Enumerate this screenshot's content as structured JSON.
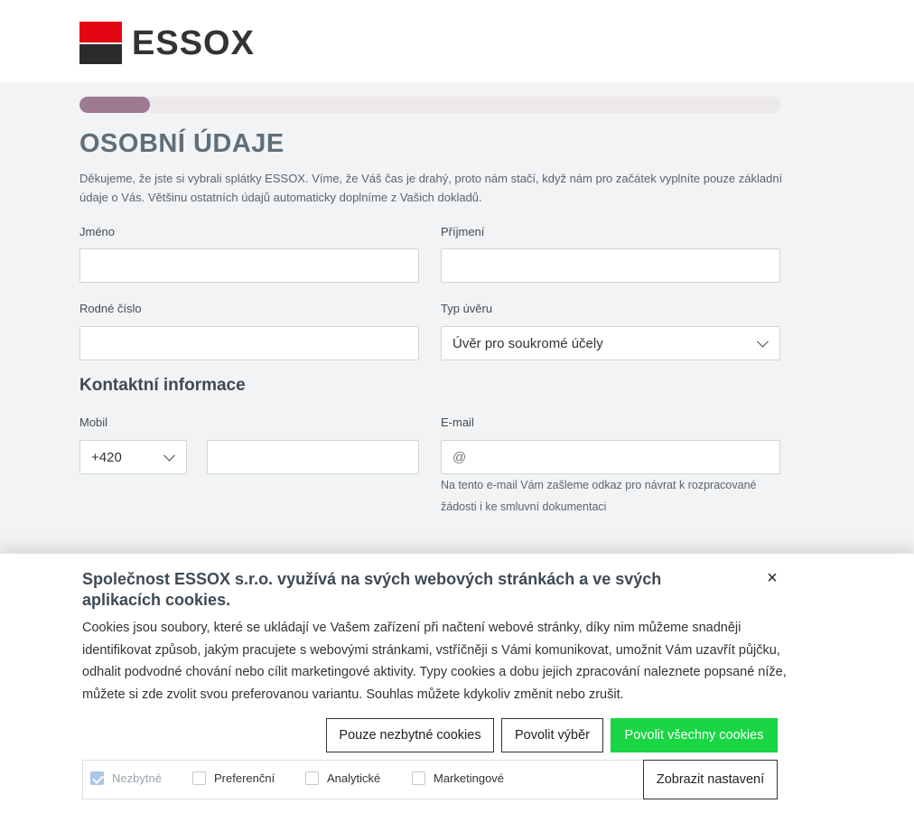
{
  "brand": {
    "name": "ESSOX",
    "red": "#e30613",
    "dark": "#2b2b2b"
  },
  "progress": {
    "fraction": 0.1,
    "fill_color": "#9d7a92"
  },
  "page": {
    "title": "OSOBNÍ ÚDAJE",
    "intro": "Děkujeme, že jste si vybrali splátky ESSOX. Víme, že Váš čas je drahý, proto nám stačí, když nám pro začátek vyplníte pouze základní údaje o Vás. Většinu ostatních údajů automaticky doplníme z Vašich dokladů."
  },
  "form": {
    "first_name": {
      "label": "Jméno",
      "value": ""
    },
    "last_name": {
      "label": "Příjmení",
      "value": ""
    },
    "birth_number": {
      "label": "Rodné číslo",
      "value": ""
    },
    "loan_type": {
      "label": "Typ úvěru",
      "value": "Úvěr pro soukromé účely"
    },
    "contact_section_title": "Kontaktní informace",
    "mobile": {
      "label": "Mobil",
      "prefix": "+420",
      "value": ""
    },
    "email": {
      "label": "E-mail",
      "placeholder": "@",
      "hint": "Na tento e-mail Vám zašleme odkaz pro návrat k rozpracované žádosti i ke smluvní dokumentaci"
    }
  },
  "cookie_banner": {
    "title": "Společnost ESSOX s.r.o. využívá na svých webových stránkách a ve svých aplikacích cookies.",
    "close_label": "×",
    "text": "Cookies jsou soubory, které se ukládají ve Vašem zařízení při načtení webové stránky, díky nim můžeme snadněji identifikovat způsob, jakým pracujete s webovými stránkami, vstříčněji s Vámi komunikovat, umožnit Vám uzavřít půjčku, odhalit podvodné chování nebo cílit marketingové aktivity. Typy cookies a dobu jejich zpracování naleznete popsané níže, můžete si zde zvolit svou preferovanou variantu. Souhlas můžete kdykoliv změnit nebo zrušit.",
    "buttons": {
      "necessary_only": "Pouze nezbytné cookies",
      "allow_selection": "Povolit výběr",
      "allow_all": "Povolit všechny cookies",
      "show_settings": "Zobrazit nastavení"
    },
    "checkboxes": [
      {
        "label": "Nezbytné",
        "checked": true,
        "disabled": true
      },
      {
        "label": "Preferenční",
        "checked": false,
        "disabled": false
      },
      {
        "label": "Analytické",
        "checked": false,
        "disabled": false
      },
      {
        "label": "Marketingové",
        "checked": false,
        "disabled": false
      }
    ],
    "accent_green": "#1ad544"
  }
}
